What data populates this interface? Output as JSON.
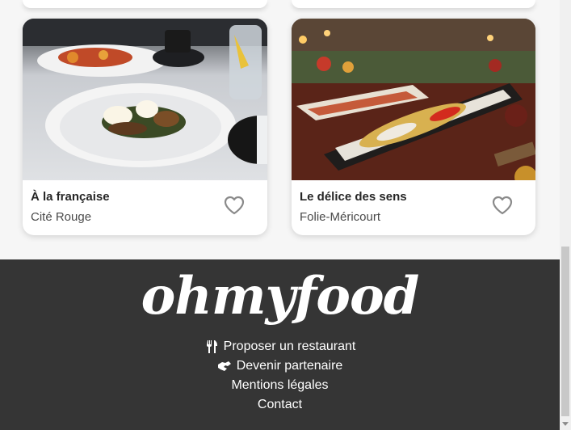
{
  "cards": [
    {
      "name": "À la française",
      "place": "Cité Rouge",
      "favorite_icon": "heart-outline-icon"
    },
    {
      "name": "Le délice des sens",
      "place": "Folie-Méricourt",
      "favorite_icon": "heart-outline-icon"
    }
  ],
  "footer": {
    "logo": "ohmyfood",
    "links": [
      {
        "label": "Proposer un restaurant",
        "icon": "utensils-icon"
      },
      {
        "label": "Devenir partenaire",
        "icon": "handshake-icon"
      },
      {
        "label": "Mentions légales"
      },
      {
        "label": "Contact"
      }
    ]
  },
  "colors": {
    "footer_bg": "#353535",
    "page_bg": "#f6f6f6",
    "heart": "#8a8a8a"
  }
}
